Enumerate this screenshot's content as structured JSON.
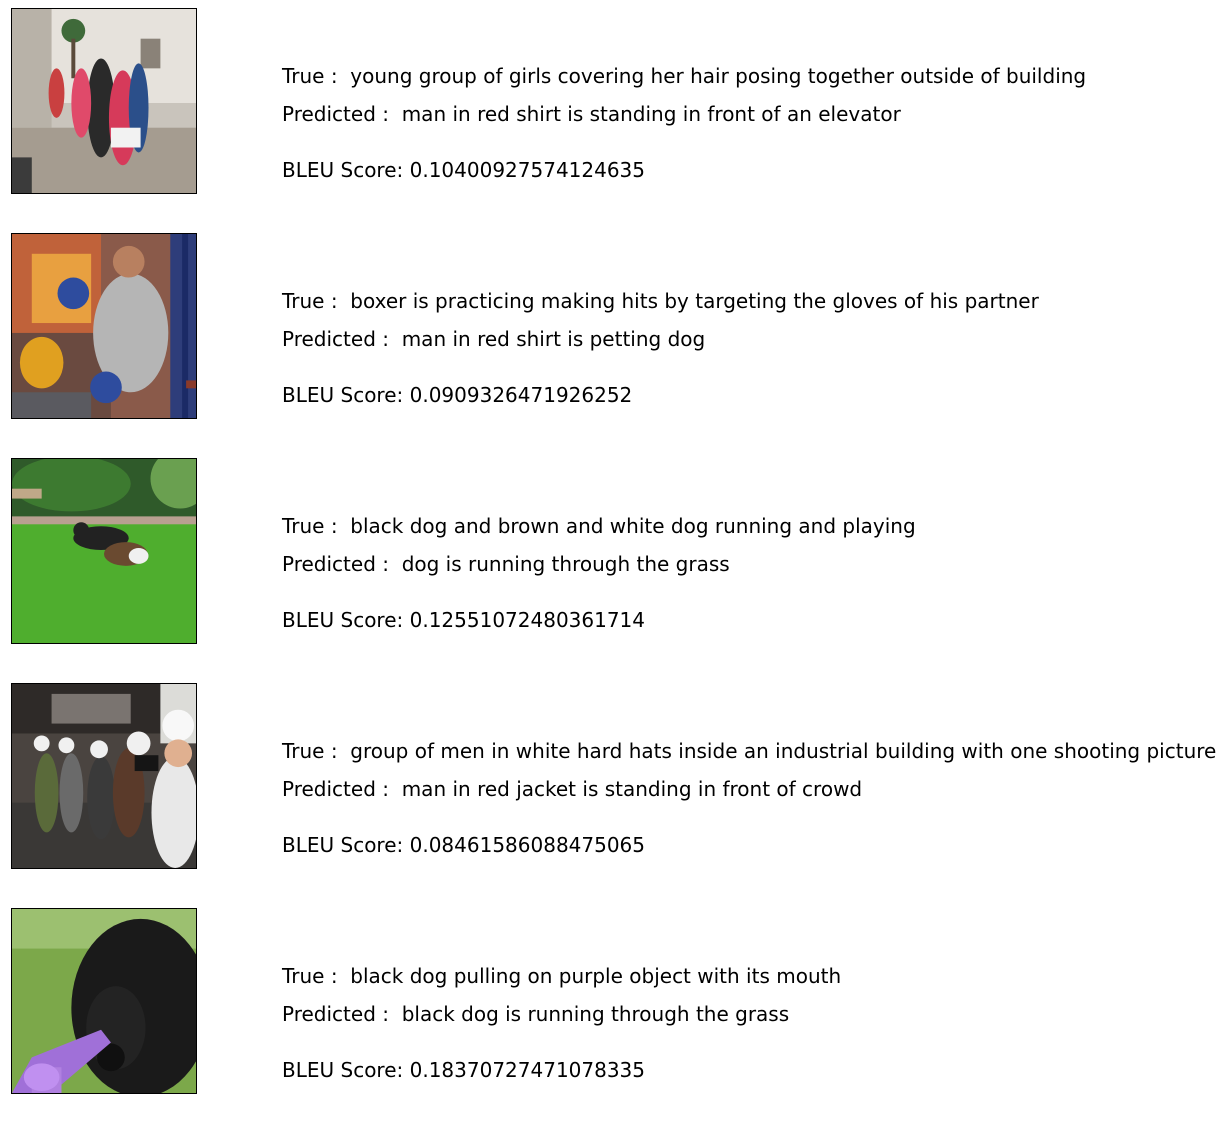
{
  "samples": [
    {
      "true_label": "True : ",
      "true_caption": " young group of girls covering her hair posing together outside of building",
      "pred_label": "Predicted : ",
      "pred_caption": " man in red shirt is standing in front of an elevator",
      "bleu_label": "BLEU Score: ",
      "bleu_value": "0.10400927574124635"
    },
    {
      "true_label": "True : ",
      "true_caption": " boxer is practicing making hits by targeting the gloves of his partner",
      "pred_label": "Predicted : ",
      "pred_caption": " man in red shirt is petting dog",
      "bleu_label": "BLEU Score: ",
      "bleu_value": "0.0909326471926252"
    },
    {
      "true_label": "True : ",
      "true_caption": " black dog and brown and white dog running and playing",
      "pred_label": "Predicted : ",
      "pred_caption": " dog is running through the grass",
      "bleu_label": "BLEU Score: ",
      "bleu_value": "0.12551072480361714"
    },
    {
      "true_label": "True : ",
      "true_caption": " group of men in white hard hats inside an industrial building with one shooting picture",
      "pred_label": "Predicted : ",
      "pred_caption": " man in red jacket is standing in front of crowd",
      "bleu_label": "BLEU Score: ",
      "bleu_value": "0.08461586088475065"
    },
    {
      "true_label": "True : ",
      "true_caption": " black dog pulling on purple object with its mouth",
      "pred_label": "Predicted : ",
      "pred_caption": " black dog is running through the grass",
      "bleu_label": "BLEU Score: ",
      "bleu_value": "0.18370727471078335"
    }
  ]
}
